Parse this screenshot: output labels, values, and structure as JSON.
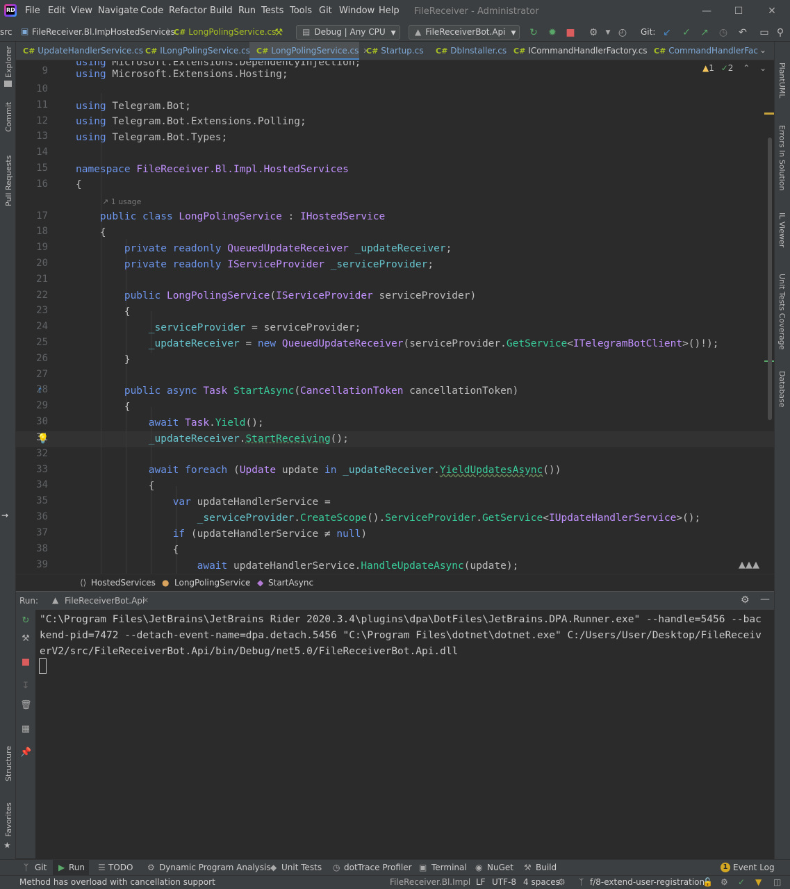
{
  "app": {
    "window_title": "FileReceiver - Administrator",
    "menu": [
      "File",
      "Edit",
      "View",
      "Navigate",
      "Code",
      "Refactor",
      "Build",
      "Run",
      "Tests",
      "Tools",
      "Git",
      "Window",
      "Help"
    ]
  },
  "navbar": {
    "crumbs": [
      "src",
      "FileReceiver.Bl.Impl",
      "HostedServices",
      "LongPolingService.cs"
    ],
    "config_combo": "Debug | Any CPU",
    "run_combo": "FileReceiverBot.Api",
    "git_label": "Git:"
  },
  "tabs": [
    {
      "label": "UpdateHandlerService.cs",
      "active": false
    },
    {
      "label": "ILongPolingService.cs",
      "active": false
    },
    {
      "label": "LongPolingService.cs",
      "active": true
    },
    {
      "label": "Startup.cs",
      "active": false
    },
    {
      "label": "DbInstaller.cs",
      "active": false
    },
    {
      "label": "ICommandHandlerFactory.cs",
      "active": false
    },
    {
      "label": "CommandHandlerFactory",
      "active": false
    }
  ],
  "tab_icon": "C#",
  "inspections": {
    "warnings": "1",
    "ok": "2"
  },
  "editor": {
    "usage_hint": "1 usage",
    "line_numbers": [
      "9",
      "10",
      "11",
      "12",
      "13",
      "14",
      "15",
      "16",
      "17",
      "18",
      "19",
      "20",
      "21",
      "22",
      "23",
      "24",
      "25",
      "26",
      "27",
      "28",
      "29",
      "30",
      "31",
      "32",
      "33",
      "34",
      "35",
      "36",
      "37",
      "38",
      "39"
    ]
  },
  "breadcrumb": [
    "HostedServices",
    "LongPolingService",
    "StartAsync"
  ],
  "run": {
    "label": "Run:",
    "tab": "FileReceiverBot.Api",
    "console": "\"C:\\Program Files\\JetBrains\\JetBrains Rider 2020.3.4\\plugins\\dpa\\DotFiles\\JetBrains.DPA.Runner.exe\" --handle=5456 --backend-pid=7472 --detach-event-name=dpa.detach.5456 \"C:\\Program Files\\dotnet\\dotnet.exe\" C:/Users/User/Desktop/FileReceiverV2/src/FileReceiverBot.Api/bin/Debug/net5.0/FileReceiverBot.Api.dll"
  },
  "left_strip": [
    "Explorer",
    "Commit",
    "Pull Requests",
    "Structure",
    "Favorites"
  ],
  "right_strip": [
    "PlantUML",
    "Errors In Solution",
    "IL Viewer",
    "Unit Tests Coverage",
    "Database"
  ],
  "bottom_tools": [
    "Git",
    "Run",
    "TODO",
    "Dynamic Program Analysis",
    "Unit Tests",
    "dotTrace Profiler",
    "Terminal",
    "NuGet",
    "Build"
  ],
  "event_log": {
    "count": "1",
    "label": "Event Log"
  },
  "status": {
    "message": "Method has overload with cancellation support",
    "project": "FileReceiver.Bl.Impl",
    "line_sep": "LF",
    "encoding": "UTF-8",
    "indent": "4 spaces",
    "branch": "f/8-extend-user-registration"
  }
}
